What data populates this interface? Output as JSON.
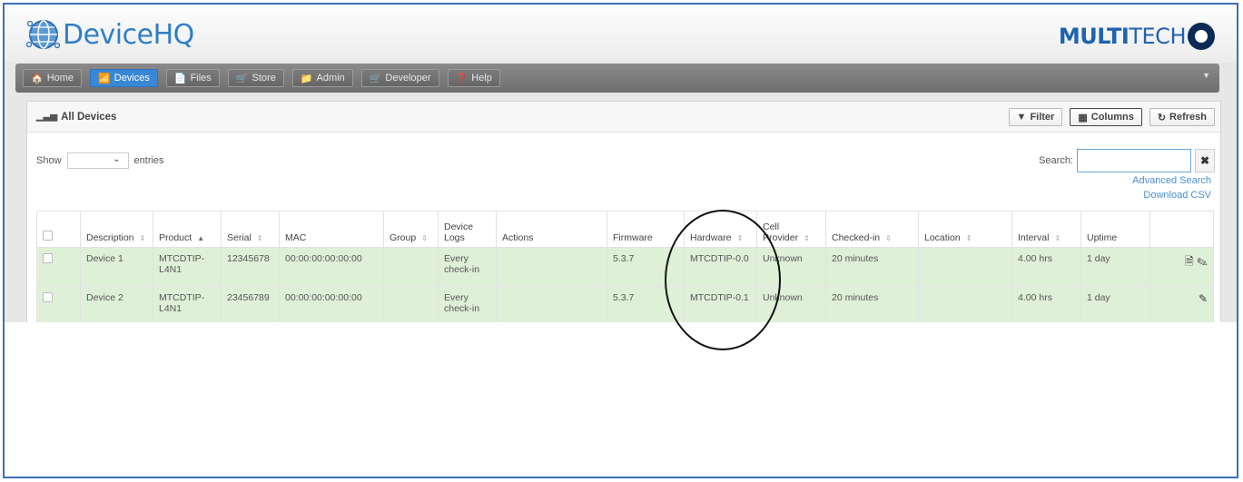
{
  "header": {
    "app_name": "DeviceHQ",
    "brand_bold": "MULTI",
    "brand_light": "TECH"
  },
  "nav": [
    {
      "icon": "home-icon",
      "glyph": "🏠",
      "label": "Home"
    },
    {
      "icon": "devices-icon",
      "glyph": "📶",
      "label": "Devices",
      "active": true
    },
    {
      "icon": "files-icon",
      "glyph": "📄",
      "label": "Files"
    },
    {
      "icon": "store-icon",
      "glyph": "🛒",
      "label": "Store"
    },
    {
      "icon": "admin-icon",
      "glyph": "📁",
      "label": "Admin"
    },
    {
      "icon": "developer-icon",
      "glyph": "🛒",
      "label": "Developer"
    },
    {
      "icon": "help-icon",
      "glyph": "❓",
      "label": "Help"
    }
  ],
  "panel": {
    "title": "All Devices",
    "filter_label": "Filter",
    "columns_label": "Columns",
    "refresh_label": "Refresh",
    "show_label": "Show",
    "entries_label": "entries",
    "search_label": "Search:",
    "search_value": "",
    "advanced_search": "Advanced Search",
    "download_csv": "Download CSV"
  },
  "table": {
    "headers": [
      "Description",
      "Product",
      "Serial",
      "MAC",
      "Group",
      "Device Logs",
      "Actions",
      "Firmware",
      "Hardware",
      "Cell Provider",
      "Checked-in",
      "Location",
      "Interval",
      "Uptime"
    ],
    "rows": [
      {
        "description": "Device 1",
        "product": "MTCDTIP-L4N1",
        "serial": "12345678",
        "mac": "00:00:00:00:00:00",
        "group": "",
        "logs": "Every check-in",
        "actions": "",
        "firmware": "5.3.7",
        "hardware": "MTCDTIP-0.0",
        "provider": "Unknown",
        "checked": "20 minutes",
        "location": "",
        "interval": "4.00 hrs",
        "uptime": "1 day"
      },
      {
        "description": "Device 2",
        "product": "MTCDTIP-L4N1",
        "serial": "23456789",
        "mac": "00:00:00:00:00:00",
        "group": "",
        "logs": "Every check-in",
        "actions": "",
        "firmware": "5.3.7",
        "hardware": "MTCDTIP-0.1",
        "provider": "Unknown",
        "checked": "20 minutes",
        "location": "",
        "interval": "4.00 hrs",
        "uptime": "1 day"
      }
    ]
  }
}
